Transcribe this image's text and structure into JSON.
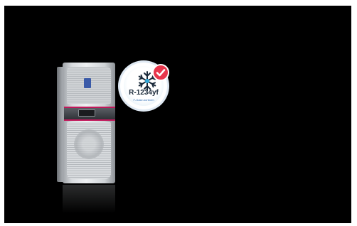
{
  "badge": {
    "code": "R-1234yf",
    "caption": "F-Gase-konform",
    "check_color": "#e8364c",
    "snowflake_color": "#1b2a3a"
  },
  "product": {
    "accent_color": "#c2185b",
    "logo_color": "#3a5aa8"
  },
  "icons": [
    "snowflake-icon",
    "checkmark-icon"
  ]
}
